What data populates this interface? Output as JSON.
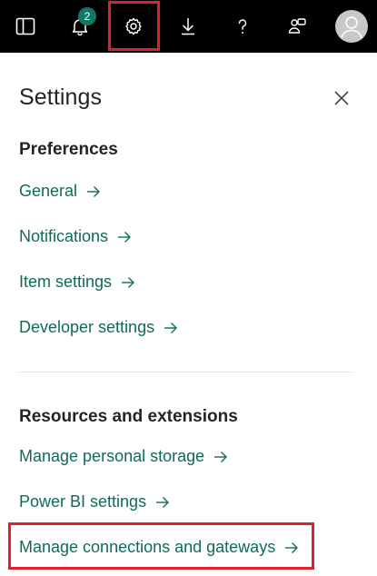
{
  "topbar": {
    "notifications_count": "2",
    "icons": [
      "panel-toggle-icon",
      "bell-icon",
      "gear-icon",
      "download-icon",
      "help-icon",
      "feedback-icon",
      "avatar-icon"
    ],
    "highlight_color": "#e0202e"
  },
  "panel": {
    "title": "Settings",
    "close_icon": "close-icon",
    "preferences": {
      "heading": "Preferences",
      "items": [
        "General",
        "Notifications",
        "Item settings",
        "Developer settings"
      ]
    },
    "resources": {
      "heading": "Resources and extensions",
      "items": [
        "Manage personal storage",
        "Power BI settings",
        "Manage connections and gateways"
      ]
    },
    "link_color": "#0f6b58"
  }
}
